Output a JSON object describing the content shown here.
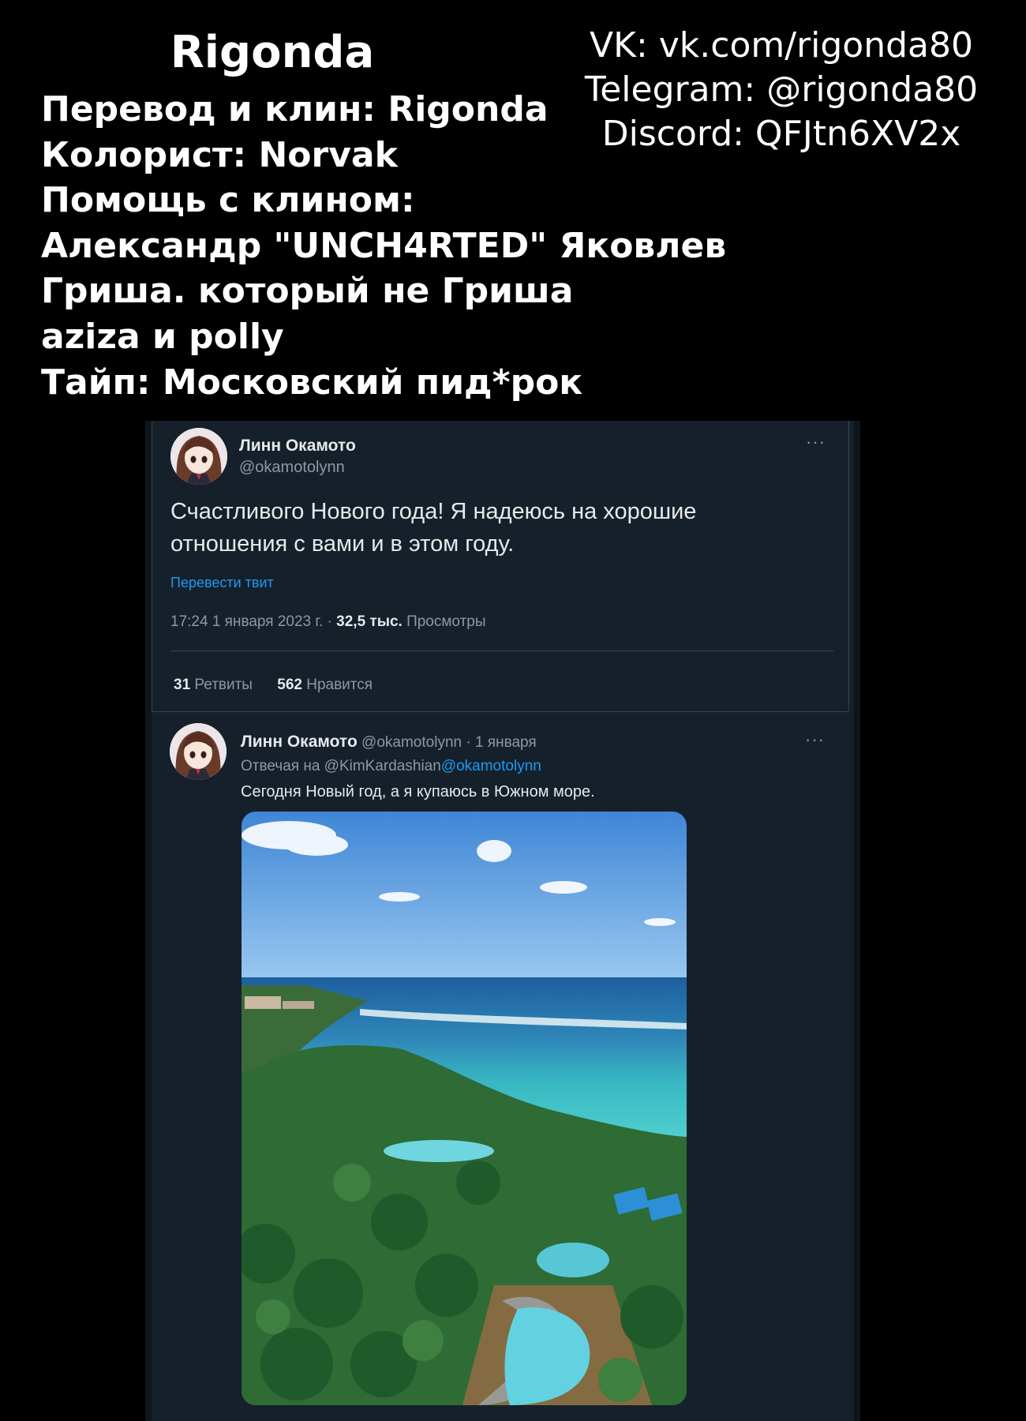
{
  "credits": {
    "title": "Rigonda",
    "lines": [
      "Перевод и клин: Rigonda",
      "Колорист: Norvak",
      "Помощь с клином:",
      "Александр  \"UNCH4RTED\" Яковлев",
      "Гриша. который не Гриша",
      "aziza и polly",
      "Тайп: Московский пид*рок"
    ],
    "contacts": [
      "VK: vk.com/rigonda80",
      "Telegram: @rigonda80",
      "Discord: QFJtn6XV2x"
    ]
  },
  "tweet": {
    "author_name": "Линн Окамото",
    "author_handle": "@okamotolynn",
    "more_icon": "ellipsis-icon",
    "text_line1": "Счастливого Нового года! Я надеюсь на хорошие",
    "text_line2": "отношения с вами и в этом году.",
    "translate_label": "Перевести твит",
    "timestamp": "17:24 1 января 2023 г. · ",
    "views_count": "32,5 тыс.",
    "views_label": " Просмотры",
    "retweets_count": "31",
    "retweets_label": " Ретвиты",
    "likes_count": "562",
    "likes_label": " Нравится"
  },
  "reply": {
    "author_name": "Линн Окамото",
    "meta": " @okamotolynn · 1 января",
    "replying_prefix": "Отвечая на @KimKardashian",
    "replying_mention": "@okamotolynn",
    "text": "Сегодня Новый год, а я купаюсь в Южном море.",
    "media": "beach-resort-photo"
  },
  "colors": {
    "page_background": "#000000",
    "tweet_background": "#15202b",
    "link_blue": "#1d9bf0",
    "muted_text": "#8b98a5"
  }
}
